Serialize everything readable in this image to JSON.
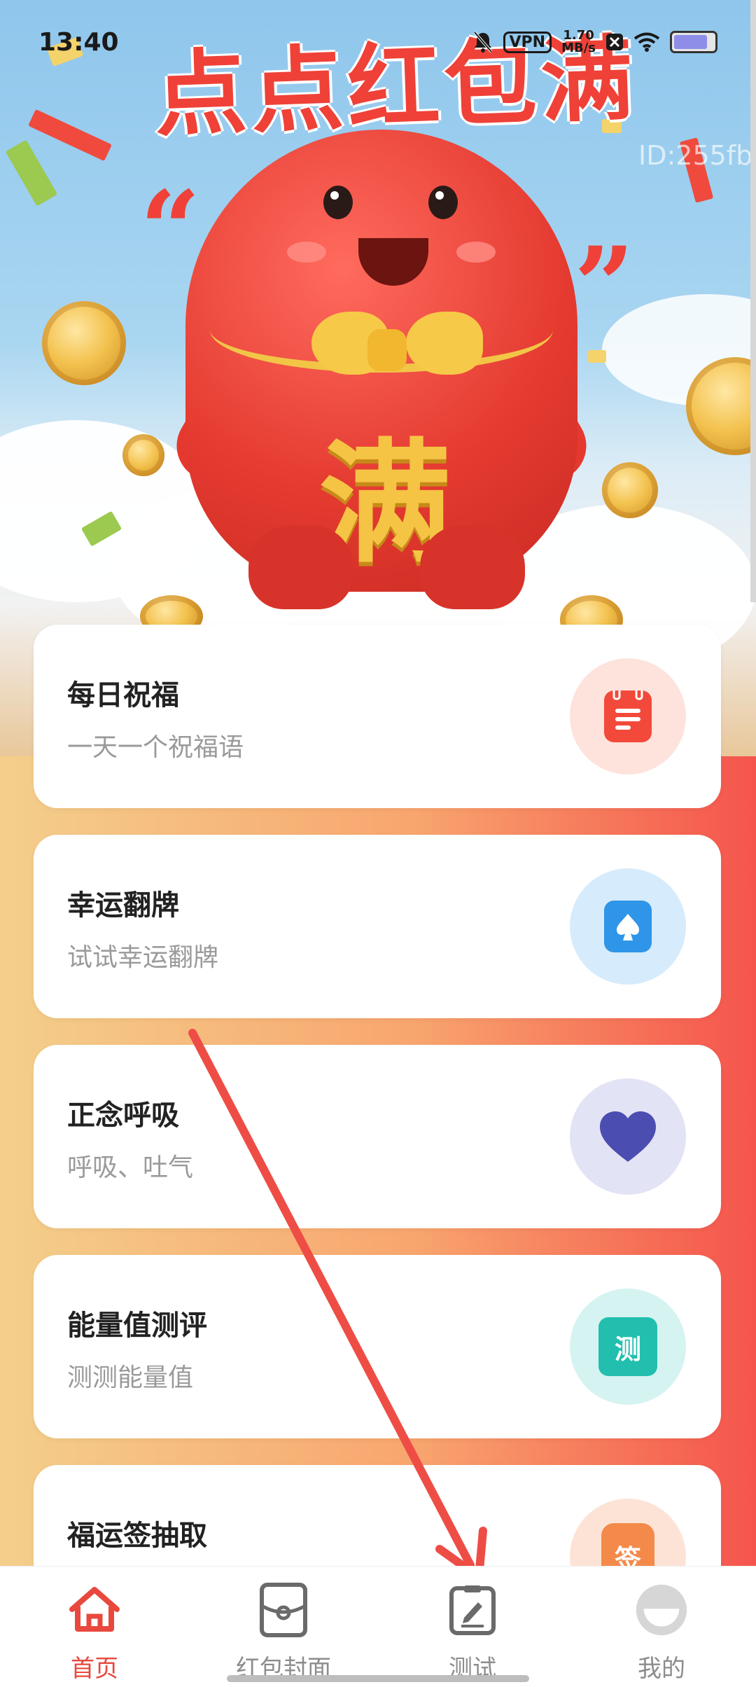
{
  "status_bar": {
    "time": "13:40",
    "vpn": "VPN",
    "net_speed_value": "1.70",
    "net_speed_unit": "MB/s",
    "battery_level": 0.75
  },
  "banner": {
    "title": "点点红包满",
    "mascot_char": "满",
    "id_text": "ID:255fb"
  },
  "cards": [
    {
      "title": "每日祝福",
      "subtitle": "一天一个祝福语",
      "icon": "notepad-icon",
      "circle_color": "#fde3dc",
      "tile_color": "#f2493a"
    },
    {
      "title": "幸运翻牌",
      "subtitle": "试试幸运翻牌",
      "icon": "spade-card-icon",
      "circle_color": "#d6ebfb",
      "tile_color": "#2f95e8"
    },
    {
      "title": "正念呼吸",
      "subtitle": "呼吸、吐气",
      "icon": "heart-icon",
      "circle_color": "#e3e3f6",
      "tile_color": "#4b4db0"
    },
    {
      "title": "能量值测评",
      "subtitle": "测测能量值",
      "icon": "test-tile-icon",
      "tile_text": "测",
      "circle_color": "#d5f3f1",
      "tile_color": "#22bfae"
    },
    {
      "title": "福运签抽取",
      "subtitle": "",
      "icon": "lottery-stick-icon",
      "tile_text": "签",
      "circle_color": "#fde3d6",
      "tile_color": "#f48a4a"
    }
  ],
  "bottom_nav": [
    {
      "label": "首页",
      "icon": "home-icon",
      "active": true
    },
    {
      "label": "红包封面",
      "icon": "red-packet-cover-icon",
      "active": false
    },
    {
      "label": "测试",
      "icon": "test-edit-icon",
      "active": false
    },
    {
      "label": "我的",
      "icon": "avatar-icon",
      "active": false
    }
  ],
  "colors": {
    "accent": "#e8483d",
    "nav_inactive": "#8c8c8c",
    "arrow": "#ee4d45"
  }
}
